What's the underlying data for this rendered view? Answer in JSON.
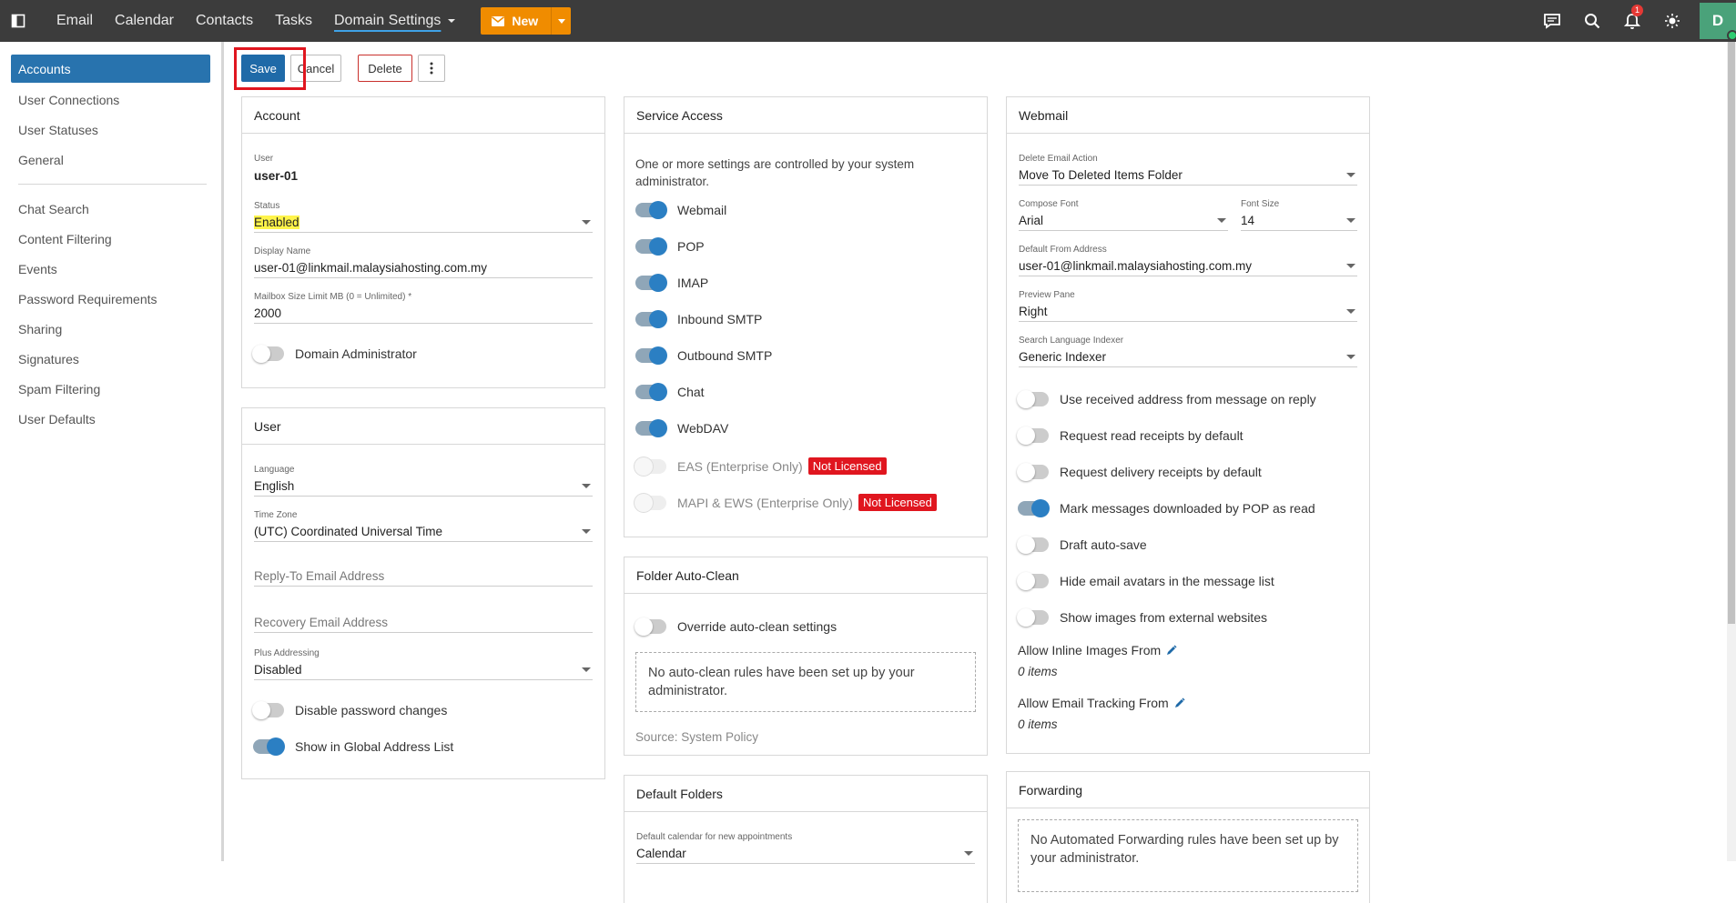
{
  "topbar": {
    "nav": [
      "Email",
      "Calendar",
      "Contacts",
      "Tasks"
    ],
    "domain_settings": "Domain Settings",
    "new_label": "New",
    "notif_count": "1",
    "avatar": "D"
  },
  "sidebar": {
    "group1": [
      "Accounts",
      "User Connections",
      "User Statuses",
      "General"
    ],
    "group2": [
      "Chat Search",
      "Content Filtering",
      "Events",
      "Password Requirements",
      "Sharing",
      "Signatures",
      "Spam Filtering",
      "User Defaults"
    ]
  },
  "toolbar": {
    "save": "Save",
    "cancel": "Cancel",
    "delete": "Delete"
  },
  "account": {
    "title": "Account",
    "user_label": "User",
    "user_value": "user-01",
    "status_label": "Status",
    "status_value": "Enabled",
    "display_label": "Display Name",
    "display_value": "user-01@linkmail.malaysiahosting.com.my",
    "mailbox_label": "Mailbox Size Limit MB (0 = Unlimited) *",
    "mailbox_value": "2000",
    "domain_admin": "Domain Administrator"
  },
  "user": {
    "title": "User",
    "language_label": "Language",
    "language_value": "English",
    "tz_label": "Time Zone",
    "tz_value": "(UTC) Coordinated Universal Time",
    "reply_to_ph": "Reply-To Email Address",
    "recovery_ph": "Recovery Email Address",
    "plus_label": "Plus Addressing",
    "plus_value": "Disabled",
    "disable_pw": "Disable password changes",
    "show_gal": "Show in Global Address List"
  },
  "service": {
    "title": "Service Access",
    "note": "One or more settings are controlled by your system administrator.",
    "items": [
      "Webmail",
      "POP",
      "IMAP",
      "Inbound SMTP",
      "Outbound SMTP",
      "Chat",
      "WebDAV"
    ],
    "eas": "EAS (Enterprise Only)",
    "mapi": "MAPI & EWS (Enterprise Only)",
    "not_licensed": "Not Licensed"
  },
  "autoclean": {
    "title": "Folder Auto-Clean",
    "override": "Override auto-clean settings",
    "empty": "No auto-clean rules have been set up by your administrator.",
    "source": "Source: System Policy"
  },
  "folders": {
    "title": "Default Folders",
    "cal_label": "Default calendar for new appointments",
    "cal_value": "Calendar"
  },
  "webmail": {
    "title": "Webmail",
    "delete_label": "Delete Email Action",
    "delete_value": "Move To Deleted Items Folder",
    "font_label": "Compose Font",
    "font_value": "Arial",
    "size_label": "Font Size",
    "size_value": "14",
    "from_label": "Default From Address",
    "from_value": "user-01@linkmail.malaysiahosting.com.my",
    "preview_label": "Preview Pane",
    "preview_value": "Right",
    "indexer_label": "Search Language Indexer",
    "indexer_value": "Generic Indexer",
    "toggles": [
      "Use received address from message on reply",
      "Request read receipts by default",
      "Request delivery receipts by default",
      "Mark messages downloaded by POP as read",
      "Draft auto-save",
      "Hide email avatars in the message list",
      "Show images from external websites"
    ],
    "inline_label": "Allow Inline Images From",
    "inline_value": "0 items",
    "tracking_label": "Allow Email Tracking From",
    "tracking_value": "0 items"
  },
  "forwarding": {
    "title": "Forwarding",
    "empty": "No Automated Forwarding rules have been set up by your administrator."
  }
}
